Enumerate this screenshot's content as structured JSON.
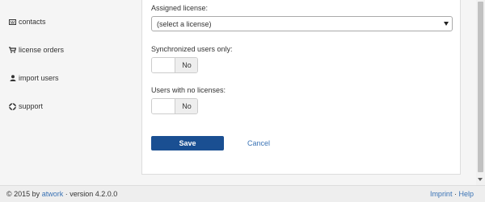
{
  "sidebar": {
    "items": [
      {
        "label": "contacts",
        "icon": "keyboard-icon"
      },
      {
        "label": "license orders",
        "icon": "cart-icon"
      },
      {
        "label": "import users",
        "icon": "user-icon"
      },
      {
        "label": "support",
        "icon": "lifebuoy-icon"
      }
    ]
  },
  "form": {
    "assigned_license": {
      "label": "Assigned license:",
      "value": "(select a license)"
    },
    "synchronized_only": {
      "label": "Synchronized users only:",
      "value": "No"
    },
    "no_licenses": {
      "label": "Users with no licenses:",
      "value": "No"
    },
    "save_label": "Save",
    "cancel_label": "Cancel"
  },
  "footer": {
    "copyright": "© 2015 by",
    "brand": "atwork",
    "version": "· version 4.2.0.0",
    "imprint": "Imprint",
    "separator": "·",
    "help": "Help"
  },
  "colors": {
    "primary": "#1a4f92",
    "link": "#3a73b5",
    "sidebar_bg": "#f5f5f5"
  }
}
